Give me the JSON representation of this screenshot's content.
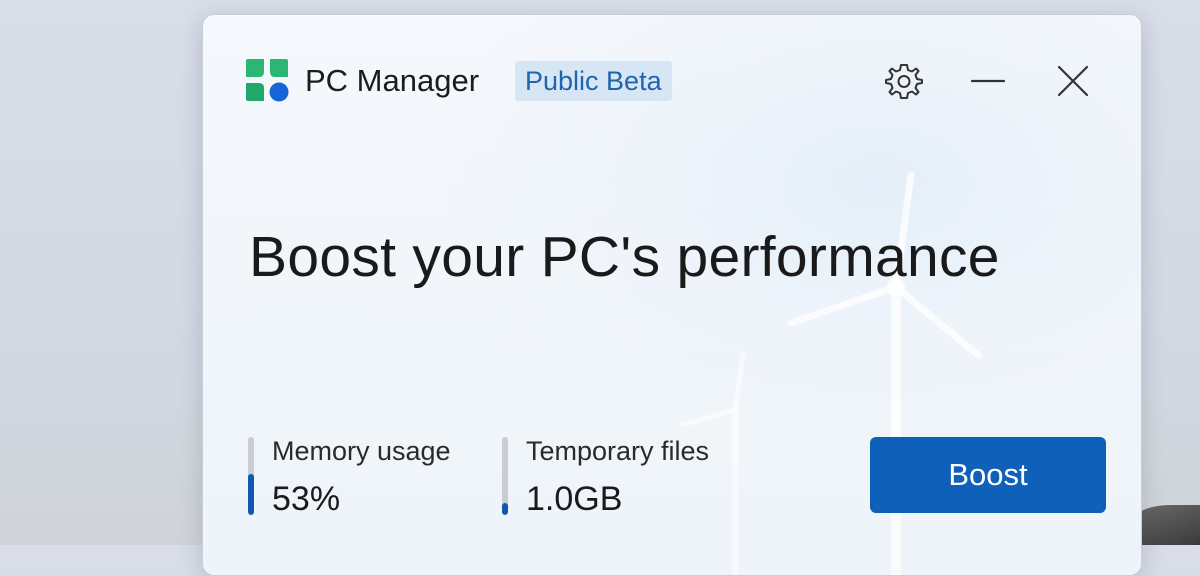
{
  "window": {
    "app_title": "PC Manager",
    "badge": "Public Beta",
    "controls": {
      "settings_icon": "gear-icon",
      "minimize_icon": "minimize-icon",
      "close_icon": "close-icon"
    }
  },
  "main": {
    "headline": "Boost your PC's performance",
    "stats": [
      {
        "label": "Memory usage",
        "value": "53%",
        "level_percent": 53
      },
      {
        "label": "Temporary files",
        "value": "1.0GB",
        "level_percent": 15
      }
    ],
    "boost_label": "Boost"
  },
  "colors": {
    "accent": "#0f60b8",
    "badge_bg": "#d6e6f5",
    "badge_text": "#1f64ad",
    "bar_track": "#c9cdd3",
    "bar_fill": "#0f57b0"
  }
}
